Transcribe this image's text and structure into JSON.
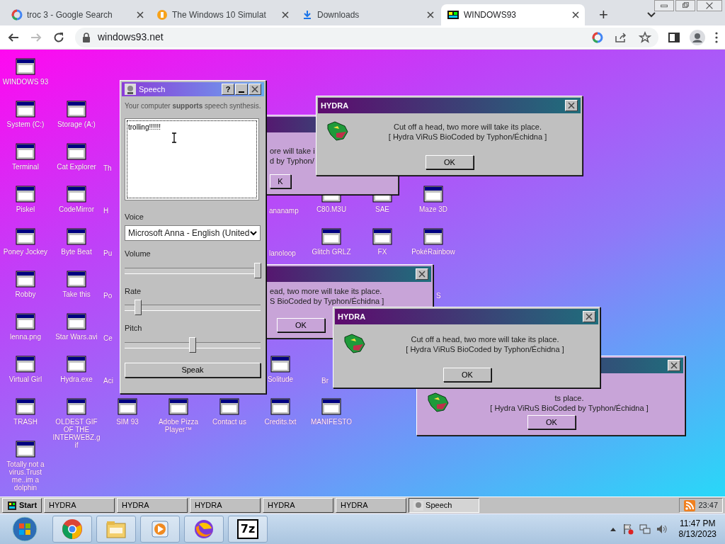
{
  "browser": {
    "tabs": [
      {
        "title": "troc 3 - Google Search",
        "selected": false
      },
      {
        "title": "The Windows 10 Simulat",
        "selected": false
      },
      {
        "title": "Downloads",
        "selected": false
      },
      {
        "title": "WINDOWS93",
        "selected": true
      }
    ],
    "new_tab": "+",
    "url": "windows93.net"
  },
  "desktop_icons": [
    {
      "label": "WINDOWS 93",
      "kind": "app"
    },
    {
      "label": "System (C:)",
      "kind": "app"
    },
    {
      "label": "Terminal",
      "kind": "app"
    },
    {
      "label": "Piskel",
      "kind": "app"
    },
    {
      "label": "Poney Jockey",
      "kind": "app"
    },
    {
      "label": "Robby",
      "kind": "app"
    },
    {
      "label": "lenna.png",
      "kind": "app"
    },
    {
      "label": "Virtual Girl",
      "kind": "app"
    },
    {
      "label": "TRASH",
      "kind": "app"
    },
    {
      "label": "Totally not a virus.Trust me..im a dolphin",
      "kind": "app"
    },
    {
      "label": "Storage (A:)",
      "kind": "app"
    },
    {
      "label": "Cat Explorer",
      "kind": "app"
    },
    {
      "label": "CodeMirror",
      "kind": "app"
    },
    {
      "label": "Byte Beat",
      "kind": "app"
    },
    {
      "label": "Take this",
      "kind": "app"
    },
    {
      "label": "Star Wars.avi",
      "kind": "app"
    },
    {
      "label": "Hydra.exe",
      "kind": "app"
    },
    {
      "label": "OLDEST GIF OF THE INTERWEBZ.gif",
      "kind": "app"
    },
    {
      "label": "Th",
      "kind": "partial"
    },
    {
      "label": "H",
      "kind": "partial"
    },
    {
      "label": "Pu",
      "kind": "partial"
    },
    {
      "label": "Po",
      "kind": "partial"
    },
    {
      "label": "Ce",
      "kind": "partial"
    },
    {
      "label": "Aci",
      "kind": "partial"
    },
    {
      "label": "SIM 93",
      "kind": "app"
    },
    {
      "label": "Adobe Pizza Player™",
      "kind": "app"
    },
    {
      "label": "Contact us",
      "kind": "app"
    },
    {
      "label": "ananamp",
      "kind": "partial"
    },
    {
      "label": "lanoloop",
      "kind": "partial"
    },
    {
      "label": "Solitude",
      "kind": "app"
    },
    {
      "label": "Credits.txt",
      "kind": "app"
    },
    {
      "label": "C80.M3U",
      "kind": "app"
    },
    {
      "label": "Glitch GRLZ",
      "kind": "app"
    },
    {
      "label": "Br",
      "kind": "partial"
    },
    {
      "label": "MANIFESTO",
      "kind": "app"
    },
    {
      "label": "SAE",
      "kind": "app"
    },
    {
      "label": "FX",
      "kind": "app"
    },
    {
      "label": "Maze 3D",
      "kind": "app"
    },
    {
      "label": "PokéRainbow",
      "kind": "app"
    },
    {
      "label": "S",
      "kind": "partial"
    }
  ],
  "dialogs": [
    {
      "active": false,
      "icon": false,
      "lines": [
        "ore will take i",
        "d by Typhon/"
      ],
      "button": "K"
    },
    {
      "active": false,
      "icon": false,
      "lines": [
        "ead, two more will take its place.",
        "S BioCoded by Typhon/Échidna ]"
      ],
      "button": "OK"
    },
    {
      "active": false,
      "icon": true,
      "lines": [
        "ts place.",
        "[ Hydra ViRuS BioCoded by Typhon/Échidna ]"
      ],
      "button": "OK"
    },
    {
      "title": "HYDRA",
      "active": true,
      "icon": true,
      "lines": [
        "Cut off a head, two more will take its place.",
        "[ Hydra ViRuS BioCoded by Typhon/Échidna ]"
      ],
      "button": "OK"
    },
    {
      "title": "HYDRA",
      "active": true,
      "icon": true,
      "lines": [
        "Cut off a head, two more will take its place.",
        "[ Hydra ViRuS BioCoded by Typhon/Échidna ]"
      ],
      "button": "OK"
    }
  ],
  "speech": {
    "title": "Speech",
    "help": "?",
    "intro": "Your computer **supports** speech synthesis.",
    "text": "trolling!!!!!!",
    "voice_label": "Voice",
    "voice": "Microsoft Anna - English (United",
    "sliders": [
      {
        "label": "Volume",
        "level": 0.98
      },
      {
        "label": "Rate",
        "level": 0.1
      },
      {
        "label": "Pitch",
        "level": 0.5
      }
    ],
    "speak": "Speak"
  },
  "taskbar": {
    "start": "Start",
    "buttons": [
      {
        "label": "HYDRA",
        "selected": false
      },
      {
        "label": "HYDRA",
        "selected": false
      },
      {
        "label": "HYDRA",
        "selected": false
      },
      {
        "label": "HYDRA",
        "selected": false
      },
      {
        "label": "HYDRA",
        "selected": false
      },
      {
        "label": "Speech",
        "selected": true
      }
    ],
    "clock": "23:47"
  },
  "os_taskbar": {
    "archive_label": "7z",
    "time": "11:47 PM",
    "date": "8/13/2023"
  }
}
